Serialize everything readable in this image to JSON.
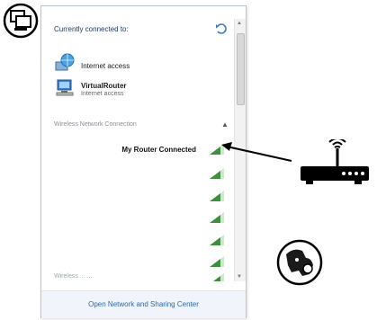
{
  "panel": {
    "connected_title": "Currently connected to:",
    "connections": [
      {
        "name": "Internet access",
        "sub": "",
        "icon": "network-globe-icon"
      },
      {
        "name": "VirtualRouter",
        "sub": "Internet access",
        "icon": "network-computer-icon"
      }
    ],
    "section_header": "Wireless Network Connection",
    "section_caret": "▲",
    "networks": [
      {
        "name": "My Router Connected",
        "signal": 5
      },
      {
        "name": "",
        "signal": 5
      },
      {
        "name": "",
        "signal": 5
      },
      {
        "name": "",
        "signal": 5
      },
      {
        "name": "",
        "signal": 5
      },
      {
        "name": "",
        "signal": 5
      },
      {
        "name": "",
        "signal": 5
      }
    ],
    "cut_row": "Wireless ... ...",
    "footer_link": "Open Network and Sharing Center"
  },
  "colors": {
    "signal_green": "#3e8e3e",
    "link_blue": "#2a67b0",
    "panel_border": "#b9c5d4"
  },
  "decor": {
    "corner_icon": "network-window-icon",
    "router": "wifi-router-icon",
    "dog": "dog-icon"
  }
}
